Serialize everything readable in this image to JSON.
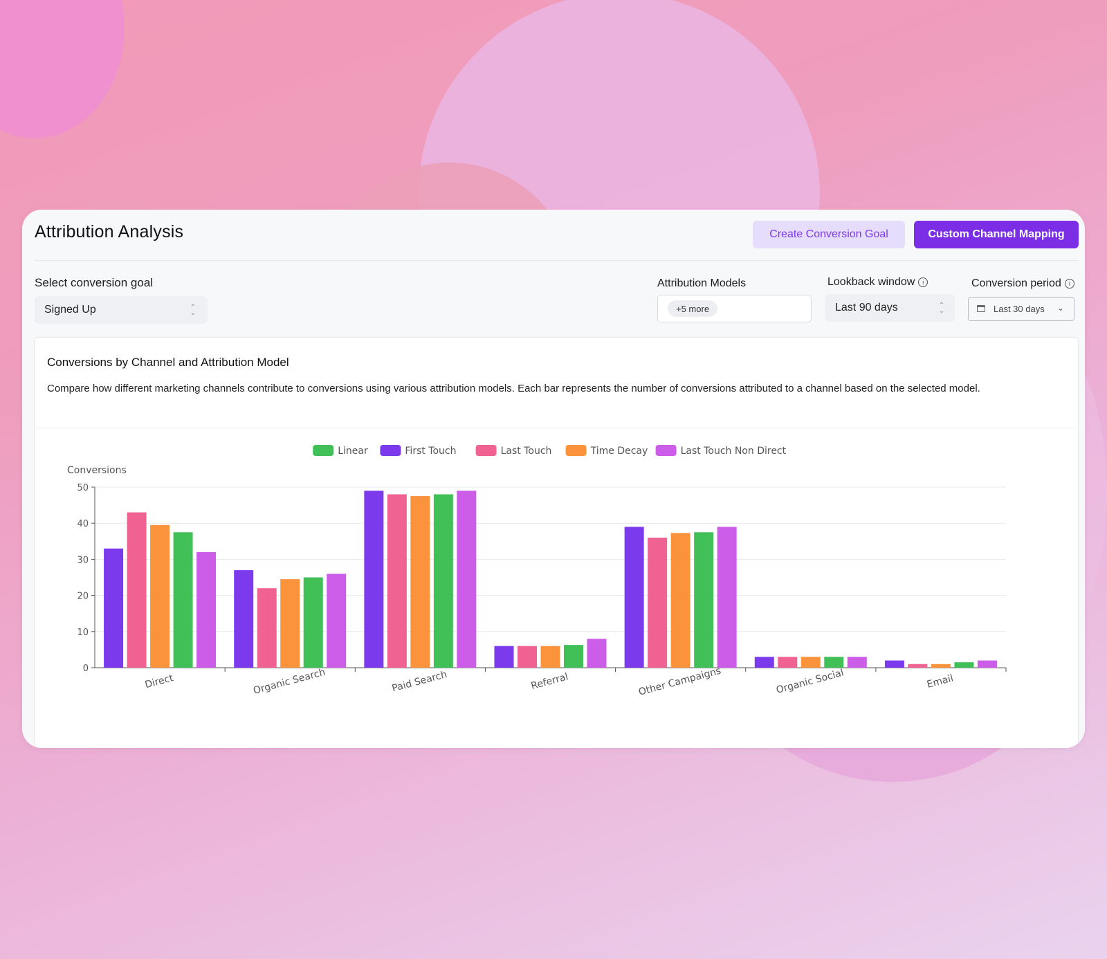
{
  "header": {
    "title": "Attribution Analysis",
    "create_goal_label": "Create Conversion Goal",
    "custom_mapping_label": "Custom Channel Mapping"
  },
  "filters": {
    "goal_label": "Select conversion goal",
    "goal_value": "Signed Up",
    "models_label": "Attribution Models",
    "models_chip": "+5 more",
    "lookback_label": "Lookback window",
    "lookback_value": "Last 90 days",
    "period_label": "Conversion period",
    "period_value": "Last 30 days"
  },
  "panel": {
    "title": "Conversions by Channel and Attribution Model",
    "description": "Compare how different marketing channels contribute to conversions using various attribution models. Each bar represents the number of conversions attributed to a channel based on the selected model."
  },
  "chart_data": {
    "type": "bar",
    "ylabel": "Conversions",
    "xlabel": "",
    "ylim": [
      0,
      50
    ],
    "yticks": [
      0,
      10,
      20,
      30,
      40,
      50
    ],
    "grid": true,
    "legend_position": "top-center",
    "legend_order": [
      "Linear",
      "First Touch",
      "Last Touch",
      "Time Decay",
      "Last Touch Non Direct"
    ],
    "categories": [
      "Direct",
      "Organic Search",
      "Paid Search",
      "Referral",
      "Other Campaigns",
      "Organic Social",
      "Email"
    ],
    "series": [
      {
        "name": "First Touch",
        "color": "#7c3aed",
        "values": [
          33,
          27,
          49,
          6,
          39,
          3,
          2
        ]
      },
      {
        "name": "Last Touch",
        "color": "#f06292",
        "values": [
          43,
          22,
          48,
          6,
          36,
          3,
          1
        ]
      },
      {
        "name": "Time Decay",
        "color": "#fb923c",
        "values": [
          39.5,
          24.5,
          47.5,
          6,
          37.3,
          3,
          1
        ]
      },
      {
        "name": "Linear",
        "color": "#40c057",
        "values": [
          37.5,
          25,
          48,
          6.3,
          37.5,
          3,
          1.5
        ]
      },
      {
        "name": "Last Touch Non Direct",
        "color": "#cc5de8",
        "values": [
          32,
          26,
          49,
          8,
          39,
          3,
          2
        ]
      }
    ]
  }
}
